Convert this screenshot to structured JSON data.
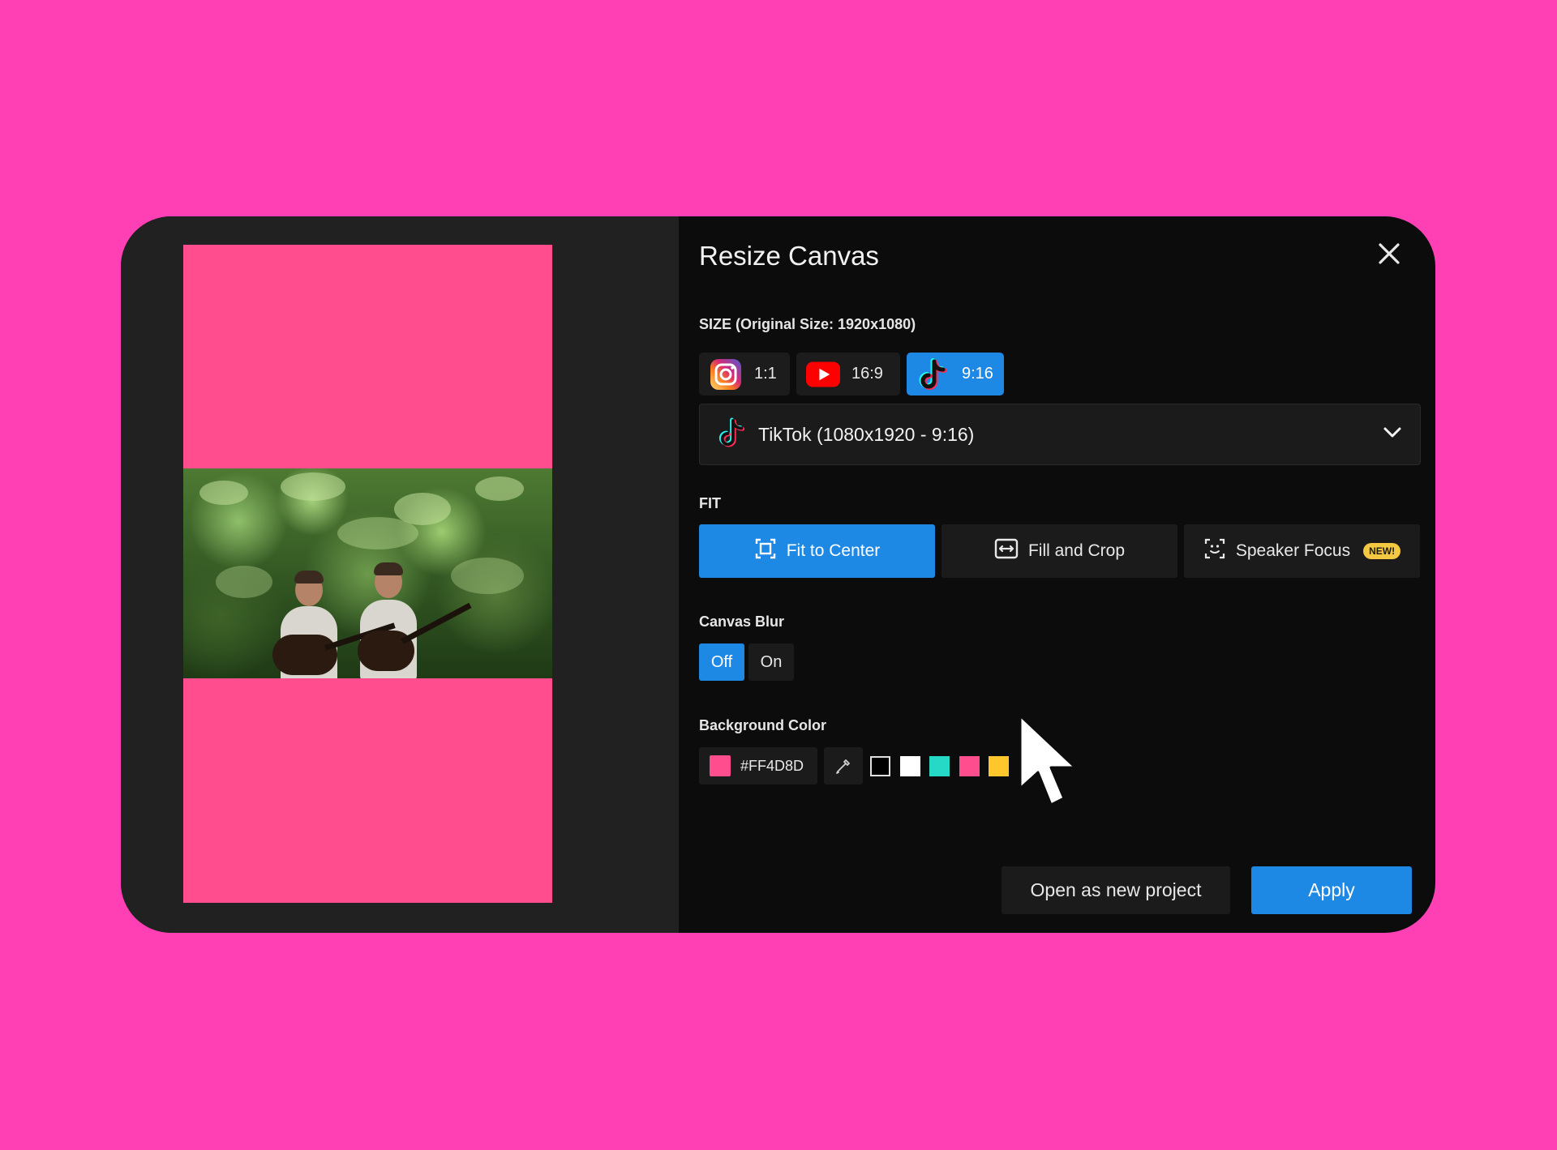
{
  "dialog": {
    "title": "Resize Canvas",
    "close_icon": "close-icon"
  },
  "size": {
    "label": "SIZE (Original Size: 1920x1080)",
    "ratios": [
      {
        "label": "1:1",
        "icon": "instagram-icon",
        "selected": false
      },
      {
        "label": "16:9",
        "icon": "youtube-icon",
        "selected": false
      },
      {
        "label": "9:16",
        "icon": "tiktok-icon",
        "selected": true
      }
    ],
    "preset": {
      "selected": "TikTok (1080x1920 - 9:16)",
      "icon": "tiktok-icon"
    }
  },
  "fit": {
    "label": "FIT",
    "options": [
      {
        "label": "Fit to Center",
        "icon": "fit-center-icon",
        "selected": true
      },
      {
        "label": "Fill and Crop",
        "icon": "fill-crop-icon",
        "selected": false
      },
      {
        "label": "Speaker Focus",
        "icon": "speaker-focus-icon",
        "selected": false,
        "badge": "NEW!"
      }
    ]
  },
  "canvas_blur": {
    "label": "Canvas Blur",
    "options": [
      {
        "label": "Off",
        "selected": true
      },
      {
        "label": "On",
        "selected": false
      }
    ]
  },
  "background_color": {
    "label": "Background Color",
    "hex": "#FF4D8D",
    "eyedropper_icon": "eyedropper-icon",
    "swatches": [
      "#000000",
      "#FFFFFF",
      "#26D9C7",
      "#FF4D8D",
      "#FFC72C"
    ]
  },
  "actions": {
    "secondary": "Open as new project",
    "primary": "Apply"
  },
  "colors": {
    "page_background": "#FF40B4",
    "accent": "#1E88E5",
    "canvas_fill": "#FF4D8D"
  }
}
